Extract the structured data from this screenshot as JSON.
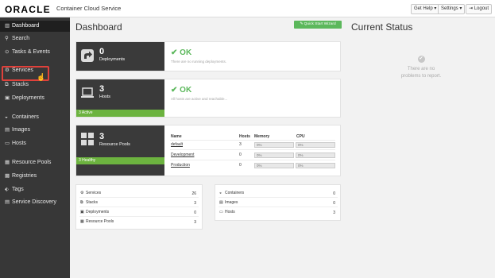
{
  "header": {
    "logo": "ORACLE",
    "app_name": "Container Cloud Service",
    "get_help": "Get Help ▾",
    "settings": "Settings ▾",
    "logout": "⇥ Logout"
  },
  "sidebar": {
    "items": [
      {
        "label": "Dashboard",
        "icon": "bar-chart-icon",
        "glyph": "▥"
      },
      {
        "label": "Search",
        "icon": "search-icon",
        "glyph": "⚲"
      },
      {
        "label": "Tasks & Events",
        "icon": "tasks-icon",
        "glyph": "⊙"
      },
      {
        "label": "Services",
        "icon": "gear-icon",
        "glyph": "⚙"
      },
      {
        "label": "Stacks",
        "icon": "stacks-icon",
        "glyph": "⧉"
      },
      {
        "label": "Deployments",
        "icon": "deployments-icon",
        "glyph": "▣"
      },
      {
        "label": "Containers",
        "icon": "containers-icon",
        "glyph": "◒"
      },
      {
        "label": "Images",
        "icon": "images-icon",
        "glyph": "▤"
      },
      {
        "label": "Hosts",
        "icon": "hosts-icon",
        "glyph": "▭"
      },
      {
        "label": "Resource Pools",
        "icon": "resource-pools-icon",
        "glyph": "▦"
      },
      {
        "label": "Registries",
        "icon": "registries-icon",
        "glyph": "▩"
      },
      {
        "label": "Tags",
        "icon": "tag-icon",
        "glyph": "⬖"
      },
      {
        "label": "Service Discovery",
        "icon": "service-discovery-icon",
        "glyph": "▤"
      }
    ]
  },
  "main": {
    "title": "Dashboard",
    "quick_start": "✎ Quick Start Wizard",
    "deployments": {
      "count": "0",
      "label": "Deployments",
      "status": "OK",
      "message": "There are no running deployments."
    },
    "hosts": {
      "count": "3",
      "label": "Hosts",
      "footer": "3 Active",
      "status": "OK",
      "message": "All hosts are active and reachable..."
    },
    "pools": {
      "count": "3",
      "label": "Resource Pools",
      "footer": "3 Healthy",
      "columns": [
        "Name",
        "Hosts",
        "Memory",
        "CPU"
      ],
      "rows": [
        {
          "name": "default",
          "hosts": "3",
          "memory": "0%",
          "cpu": "0%"
        },
        {
          "name": "Development",
          "hosts": "0",
          "memory": "0%",
          "cpu": "0%"
        },
        {
          "name": "Production",
          "hosts": "0",
          "memory": "0%",
          "cpu": "0%"
        }
      ]
    },
    "summary_left": [
      {
        "label": "Services",
        "value": "26",
        "glyph": "⚙"
      },
      {
        "label": "Stacks",
        "value": "3",
        "glyph": "⧉"
      },
      {
        "label": "Deployments",
        "value": "0",
        "glyph": "▣"
      },
      {
        "label": "Resource Pools",
        "value": "3",
        "glyph": "▦"
      }
    ],
    "summary_right": [
      {
        "label": "Containers",
        "value": "0",
        "glyph": "◒"
      },
      {
        "label": "Images",
        "value": "0",
        "glyph": "▤"
      },
      {
        "label": "Hosts",
        "value": "3",
        "glyph": "▭"
      }
    ]
  },
  "status_panel": {
    "title": "Current Status",
    "message_line1": "There are no",
    "message_line2": "problems to report."
  },
  "colors": {
    "accent_green": "#5cb85c",
    "highlight_red": "#e0413b",
    "sidebar": "#373737"
  }
}
